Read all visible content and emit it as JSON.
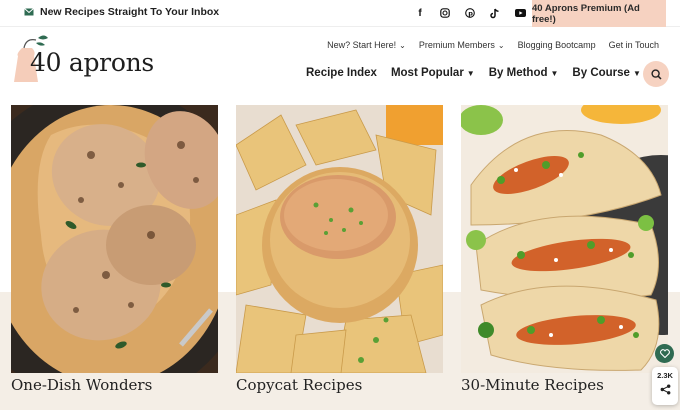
{
  "topbar": {
    "newsletter_label": "New Recipes Straight To Your Inbox",
    "premium_label": "40 Aprons Premium (Ad free!)",
    "social_icons": [
      "facebook-icon",
      "instagram-icon",
      "pinterest-icon",
      "tiktok-icon",
      "youtube-icon"
    ]
  },
  "logo": {
    "text": "40 aprons"
  },
  "util_nav": {
    "start": "New? Start Here!",
    "members": "Premium Members",
    "bootcamp": "Blogging Bootcamp",
    "contact": "Get in Touch"
  },
  "main_nav": {
    "recipe_index": "Recipe Index",
    "most_popular": "Most Popular",
    "by_method": "By Method",
    "by_course": "By Course"
  },
  "cards": [
    {
      "title": "One-Dish Wonders"
    },
    {
      "title": "Copycat Recipes"
    },
    {
      "title": "30-Minute Recipes"
    }
  ],
  "share": {
    "count": "2.3K"
  },
  "colors": {
    "accent": "#f6d2c1",
    "band": "#f4eee6",
    "fav": "#2f6b52"
  }
}
